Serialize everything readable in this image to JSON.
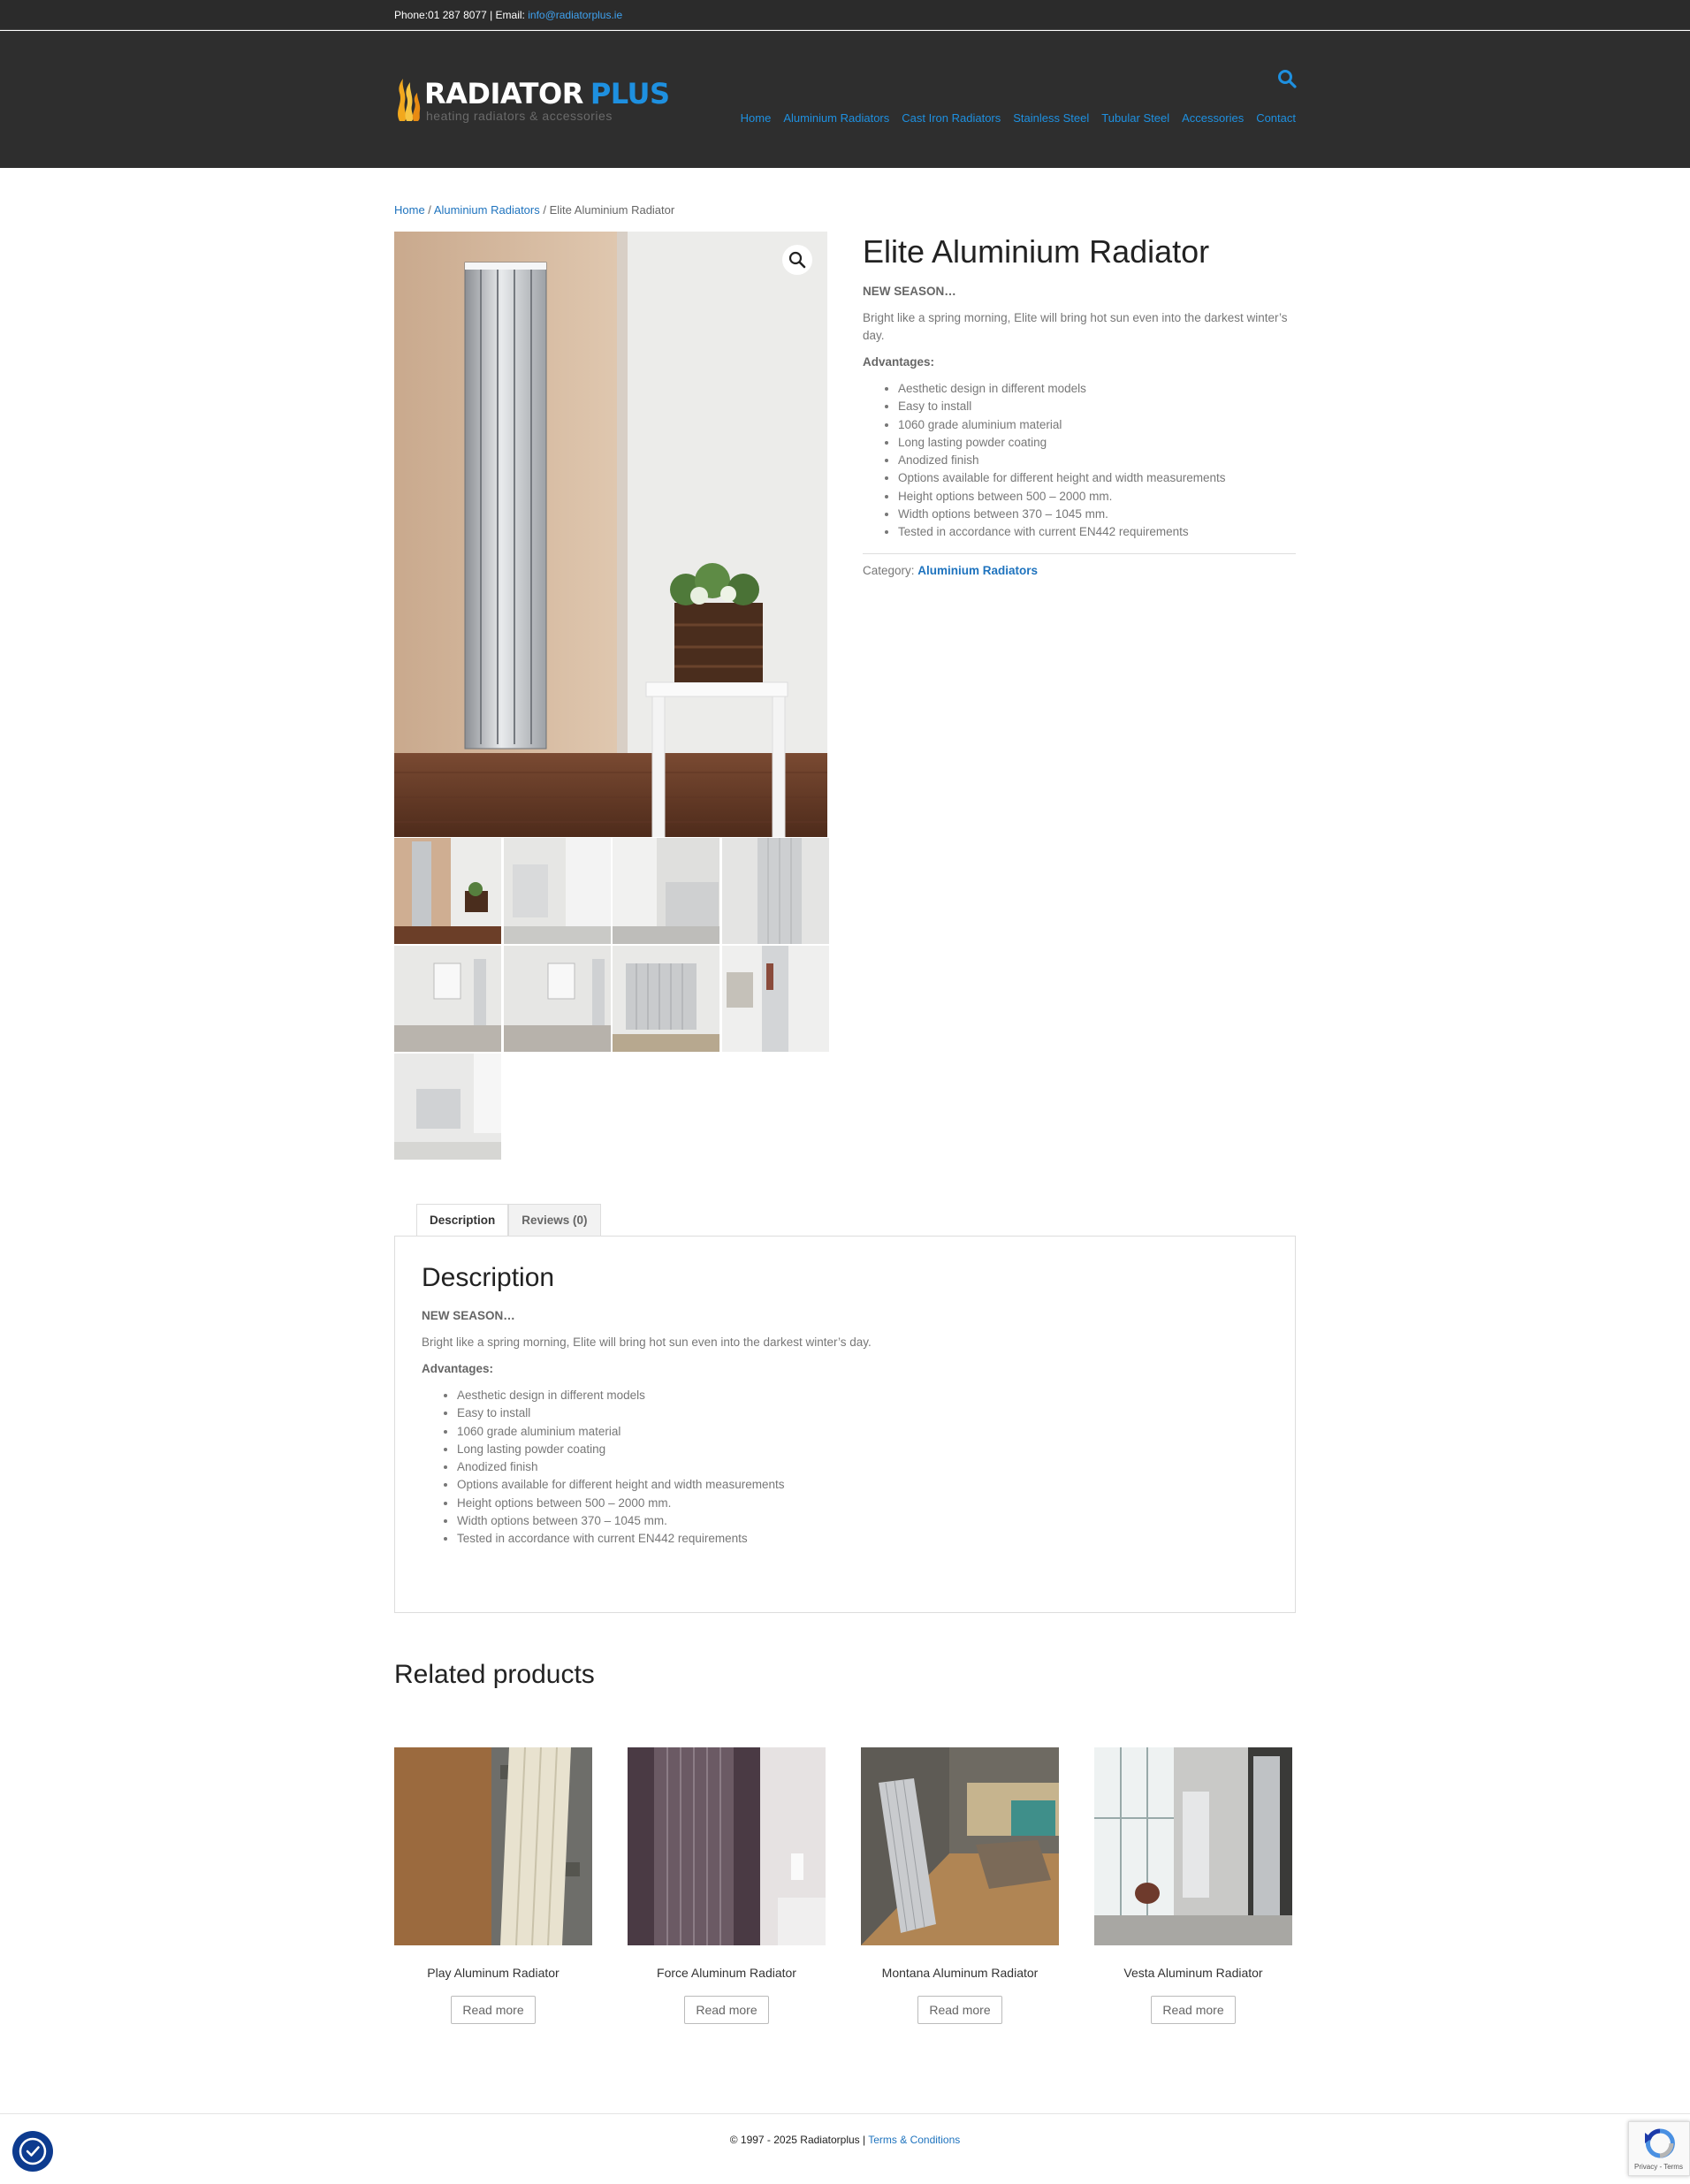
{
  "topbar": {
    "phone_text": "Phone:01 287 8077 | Email: ",
    "email": "info@radiatorplus.ie"
  },
  "header": {
    "logo_main": "RADIATOR",
    "logo_plus": "PLUS",
    "logo_sub": "heating radiators & accessories",
    "nav": [
      "Home",
      "Aluminium Radiators",
      "Cast Iron Radiators",
      "Stainless Steel",
      "Tubular Steel",
      "Accessories",
      "Contact"
    ]
  },
  "breadcrumb": {
    "home": "Home",
    "sep1": " / ",
    "category": "Aluminium Radiators",
    "sep2": " / ",
    "current": "Elite Aluminium Radiator"
  },
  "product": {
    "title": "Elite Aluminium Radiator",
    "season": "NEW SEASON…",
    "intro": "Bright like a spring morning, Elite will bring hot sun even into the darkest winter’s day.",
    "advantages_label": "Advantages:",
    "advantages": [
      "Aesthetic design in different models",
      "Easy to install",
      "1060 grade aluminium material",
      "Long lasting powder coating",
      "Anodized finish",
      "Options available for different height and width measurements",
      "Height options between 500 – 2000 mm.",
      "Width options between 370 – 1045 mm.",
      "Tested in accordance with current EN442 requirements"
    ],
    "category_label": "Category: ",
    "category": "Aluminium Radiators"
  },
  "tabs": {
    "description": "Description",
    "reviews": "Reviews (0)",
    "panel_title": "Description"
  },
  "related": {
    "title": "Related products",
    "items": [
      {
        "name": "Play Aluminum Radiator",
        "button": "Read more"
      },
      {
        "name": "Force Aluminum Radiator",
        "button": "Read more"
      },
      {
        "name": "Montana Aluminum Radiator",
        "button": "Read more"
      },
      {
        "name": "Vesta Aluminum Radiator",
        "button": "Read more"
      }
    ]
  },
  "footer": {
    "copyright": "© 1997 - 2025 Radiatorplus | ",
    "terms": "Terms & Conditions"
  },
  "recaptcha": {
    "text": "Privacy - Terms"
  },
  "colors": {
    "accent": "#1e73be",
    "header_bg": "#2e2e2e",
    "topbar_bg": "#2b2b2b"
  },
  "icons": [
    "search-icon",
    "zoom-icon",
    "cookie-icon",
    "recaptcha-icon",
    "flame-icon"
  ]
}
